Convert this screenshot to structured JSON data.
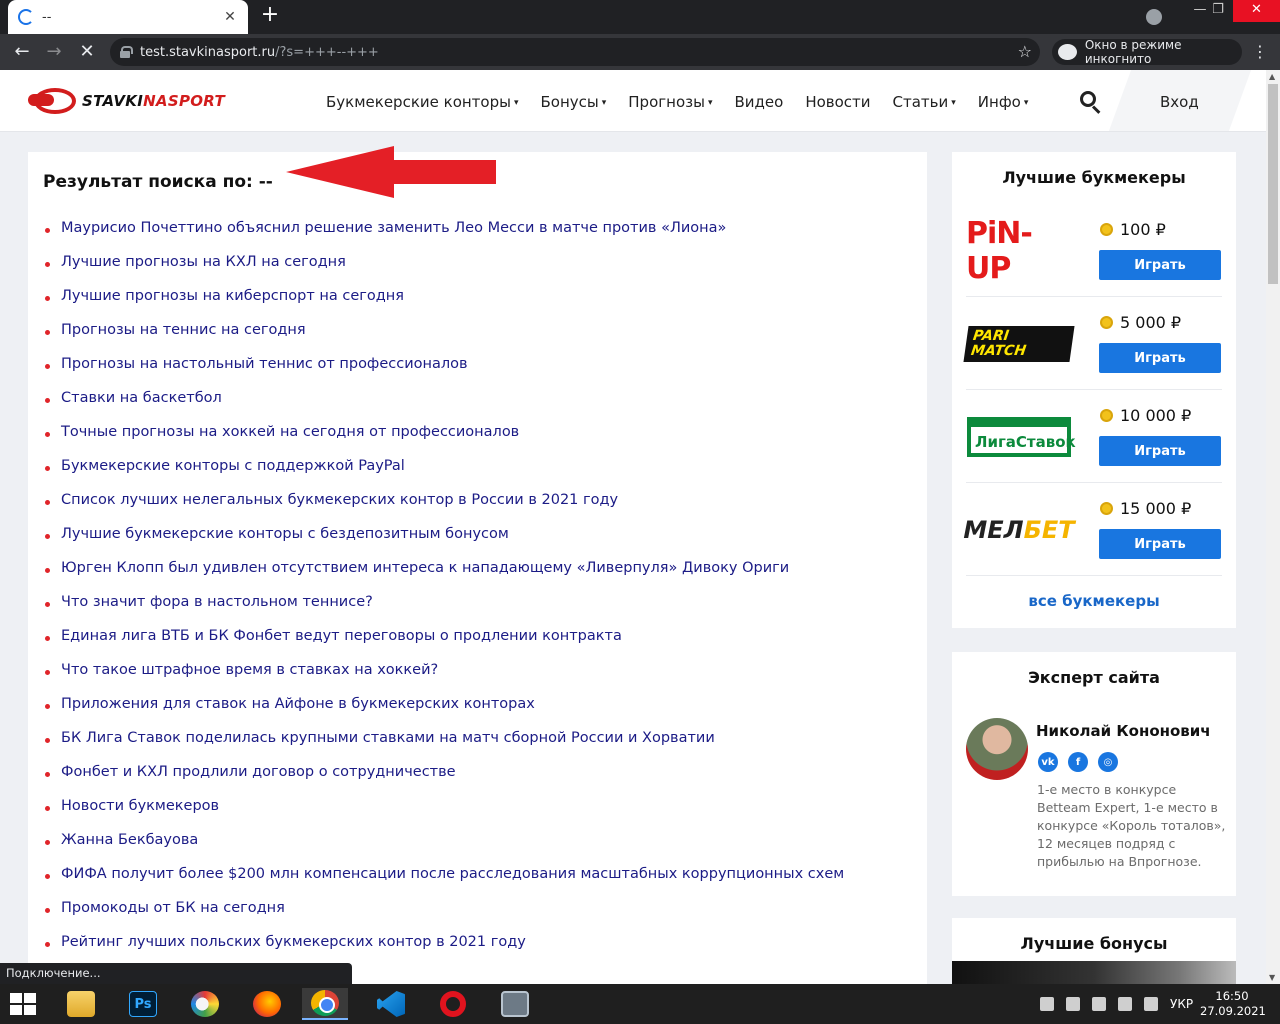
{
  "browser": {
    "tab_title": "--",
    "tab_close": "✕",
    "new_tab": "+",
    "url_host": "test.stavkinasport.ru",
    "url_path": "/?s=+++--+++",
    "incognito_label": "Окно в режиме инкогнито",
    "status_text": "Подключение..."
  },
  "site": {
    "logo_part1": "STAVKI",
    "logo_part2": "NASPORT",
    "nav": [
      {
        "label": "Букмекерские конторы",
        "dropdown": true
      },
      {
        "label": "Бонусы",
        "dropdown": true
      },
      {
        "label": "Прогнозы",
        "dropdown": true
      },
      {
        "label": "Видео",
        "dropdown": false
      },
      {
        "label": "Новости",
        "dropdown": false
      },
      {
        "label": "Статьи",
        "dropdown": true
      },
      {
        "label": "Инфо",
        "dropdown": true
      }
    ],
    "dropdown_arrow": "▾",
    "login": "Вход"
  },
  "search": {
    "title": "Результат поиска по: --",
    "results": [
      "Маурисио Почеттино объяснил решение заменить Лео Месси в матче против «Лиона»",
      "Лучшие прогнозы на КХЛ на сегодня",
      "Лучшие прогнозы на киберспорт на сегодня",
      "Прогнозы на теннис на сегодня",
      "Прогнозы на настольный теннис от профессионалов",
      "Ставки на баскетбол",
      "Точные прогнозы на хоккей на сегодня от профессионалов",
      "Букмекерские конторы с поддержкой PayPal",
      "Список лучших нелегальных букмекерских контор в России в 2021 году",
      "Лучшие букмекерские конторы с бездепозитным бонусом",
      "Юрген Клопп был удивлен отсутствием интереса к нападающему «Ливерпуля» Дивоку Ориги",
      "Что значит фора в настольном теннисе?",
      "Единая лига ВТБ и БК Фонбет ведут переговоры о продлении контракта",
      "Что такое штрафное время в ставках на хоккей?",
      "Приложения для ставок на Айфоне в букмекерских конторах",
      "БК Лига Ставок поделилась крупными ставками на матч сборной России и Хорватии",
      "Фонбет и КХЛ продлили договор о сотрудничестве",
      "Новости букмекеров",
      "Жанна Бекбауова",
      "ФИФА получит более $200 млн компенсации после расследования масштабных коррупционных схем",
      "Промокоды от БК на сегодня",
      "Рейтинг лучших польских букмекерских контор в 2021 году"
    ]
  },
  "sidebar": {
    "best_title": "Лучшие букмекеры",
    "bookmakers": [
      {
        "name": "PiN-UP",
        "bonus": "100 ₽",
        "button": "Играть"
      },
      {
        "name": "PARI MATCH",
        "bonus": "5 000 ₽",
        "button": "Играть"
      },
      {
        "name": "ЛигаСтавок",
        "bonus": "10 000 ₽",
        "button": "Играть"
      },
      {
        "name_part1": "МЕЛ",
        "name_part2": "БЕТ",
        "bonus": "15 000 ₽",
        "button": "Играть"
      }
    ],
    "all_link": "все букмекеры",
    "expert_title": "Эксперт сайта",
    "expert_name": "Николай Кононович",
    "expert_desc": "1-е место в конкурсе Betteam Expert, 1-е место в конкурсе «Король тоталов», 12 месяцев подряд с прибылью на Впрогнозе.",
    "socials": [
      "vk",
      "f",
      "ig"
    ],
    "bonuses_title": "Лучшие бонусы"
  },
  "taskbar": {
    "lang": "УКР",
    "time": "16:50",
    "date": "27.09.2021"
  },
  "colors": {
    "accent_red": "#e0252a",
    "link_blue": "#1c1c86",
    "button_blue": "#1976e0"
  }
}
